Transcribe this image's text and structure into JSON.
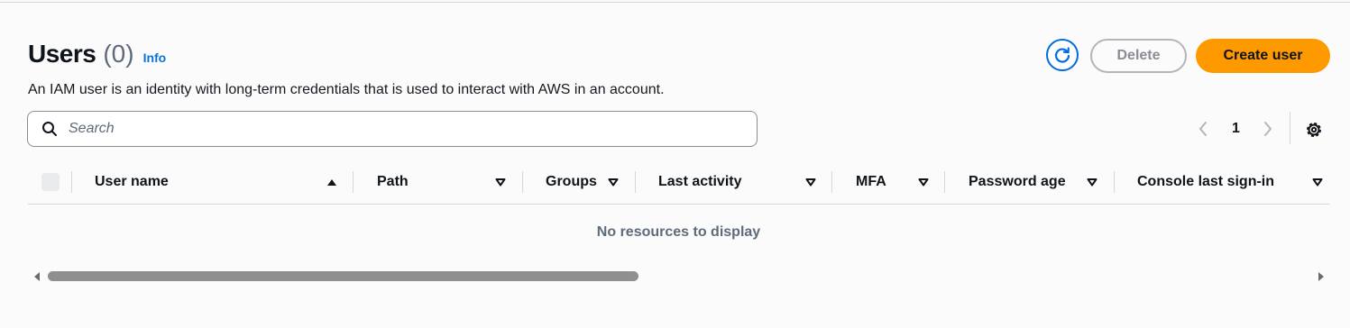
{
  "header": {
    "title": "Users",
    "count": "(0)",
    "info_link": "Info",
    "description": "An IAM user is an identity with long-term credentials that is used to interact with AWS in an account."
  },
  "actions": {
    "refresh_icon": "refresh-icon",
    "delete_label": "Delete",
    "create_label": "Create user",
    "accent_color": "#ff9900",
    "link_color": "#0972d3"
  },
  "search": {
    "placeholder": "Search",
    "value": ""
  },
  "pagination": {
    "current_page": "1"
  },
  "table": {
    "columns": [
      {
        "label": "User name",
        "sort": "ascending"
      },
      {
        "label": "Path",
        "sort": "none"
      },
      {
        "label": "Groups",
        "sort": "none"
      },
      {
        "label": "Last activity",
        "sort": "none"
      },
      {
        "label": "MFA",
        "sort": "none"
      },
      {
        "label": "Password age",
        "sort": "none"
      },
      {
        "label": "Console last sign-in",
        "sort": "none"
      }
    ],
    "empty_message": "No resources to display",
    "rows": []
  }
}
